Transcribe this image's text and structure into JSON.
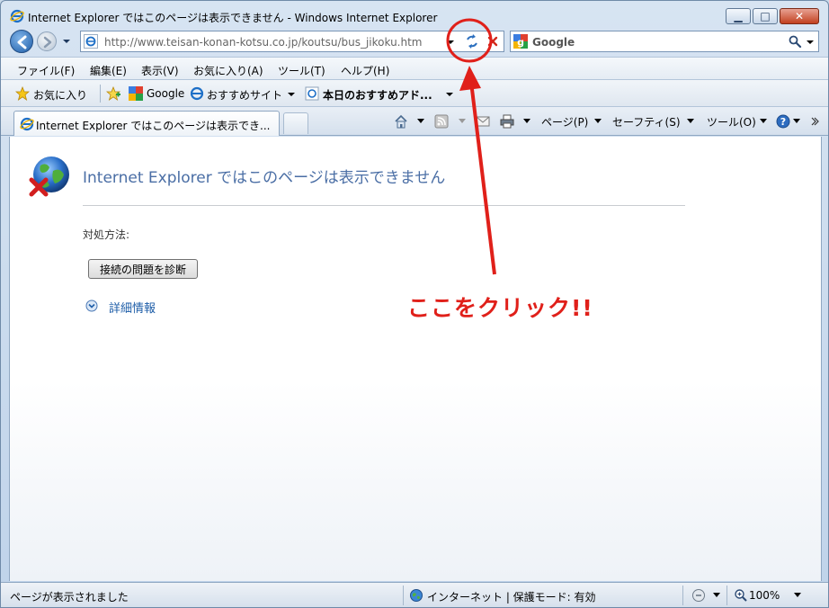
{
  "window": {
    "title": "Internet Explorer ではこのページは表示できません - Windows Internet Explorer"
  },
  "address_bar": {
    "url": "http://www.teisan-konan-kotsu.co.jp/koutsu/bus_jikoku.htm"
  },
  "search": {
    "provider": "Google"
  },
  "menu": {
    "items": [
      "ファイル(F)",
      "編集(E)",
      "表示(V)",
      "お気に入り(A)",
      "ツール(T)",
      "ヘルプ(H)"
    ]
  },
  "favorites_bar": {
    "favorites_label": "お気に入り",
    "google_label": "Google",
    "suggested_sites": "おすすめサイト",
    "recommended_addons": "本日のおすすめアド..."
  },
  "tab": {
    "title": "Internet Explorer ではこのページは表示でき..."
  },
  "command_bar": {
    "page": "ページ(P)",
    "safety": "セーフティ(S)",
    "tools": "ツール(O)"
  },
  "content": {
    "heading": "Internet Explorer ではこのページは表示できません",
    "fix_label": "対処方法:",
    "diagnose_button": "接続の問題を診断",
    "details_link": "詳細情報"
  },
  "annotation": {
    "text": "ここをクリック!!",
    "color": "#e0201a"
  },
  "status_bar": {
    "status": "ページが表示されました",
    "zone": "インターネット | 保護モード: 有効",
    "zoom": "100%"
  },
  "icons": [
    "ie-icon",
    "back-arrow-icon",
    "forward-arrow-icon",
    "refresh-icon",
    "stop-icon",
    "google-icon",
    "search-icon",
    "star-icon",
    "add-favorite-icon",
    "home-icon",
    "rss-feed-icon",
    "mail-icon",
    "print-icon",
    "help-icon",
    "globe-error-icon",
    "expand-icon",
    "globe-zone-icon",
    "zoom-icon"
  ]
}
